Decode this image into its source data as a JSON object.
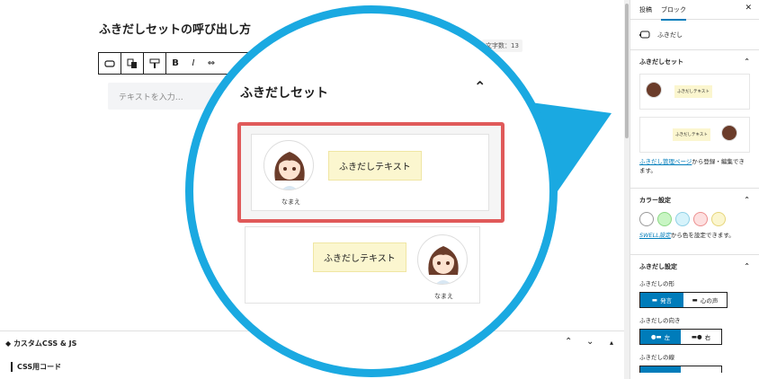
{
  "editor": {
    "post_title": "ふきだしセットの呼び出し方",
    "char_count": "文字数：13",
    "text_placeholder": "テキストを入力…",
    "toolbar": {
      "bold": "B",
      "italic": "I",
      "link": "⇔"
    },
    "custom_css_title": "カスタムCSS & JS",
    "css_label": "CSS用コード"
  },
  "magnifier": {
    "section_title": "ふきだしセット",
    "sample1": {
      "bubble_text": "ふきだしテキスト",
      "avatar_name": "なまえ",
      "side": "left"
    },
    "sample2": {
      "bubble_text": "ふきだしテキスト",
      "avatar_name": "なまえ",
      "side": "right"
    },
    "accent_color": "#1aa9e1",
    "highlight_color": "#e05a5a",
    "bubble_color": "#fbf6cf"
  },
  "sidebar": {
    "tabs": [
      "投稿",
      "ブロック"
    ],
    "active_tab": "ブロック",
    "block_name": "ふきだし",
    "set_section": "ふきだしセット",
    "preset_text": "ふきだしテキスト",
    "manage_link": "ふきだし管理ページ",
    "manage_rest": "から登録・編集できます。",
    "color_section": "カラー設定",
    "swell_link": "SWELL設定",
    "swell_rest": "から色を設定できます。",
    "swatch_colors": [
      "#ffffff",
      "#c8f5c3",
      "#d6f3fb",
      "#fde0e0",
      "#fbf6cf"
    ],
    "bubble_section": "ふきだし設定",
    "shape_label": "ふきだしの形",
    "shape_options": [
      "発言",
      "心の声"
    ],
    "direction_label": "ふきだしの向き",
    "direction_options": [
      "左",
      "右"
    ],
    "line_label": "ふきだしの線"
  }
}
